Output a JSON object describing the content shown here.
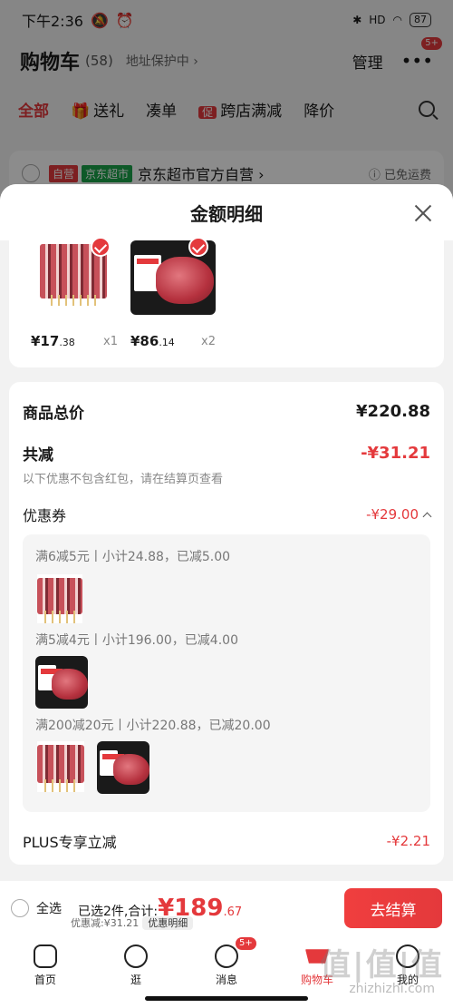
{
  "status": {
    "time": "下午2:36",
    "battery": "87",
    "signal": "HD"
  },
  "header": {
    "title": "购物车",
    "count": "(58)",
    "address": "地址保护中 ›",
    "manage": "管理",
    "more_badge": "5+"
  },
  "tabs": [
    "全部",
    "送礼",
    "凑单",
    "跨店满减",
    "降价"
  ],
  "promo_tag": "促",
  "shop": {
    "tag_self": "自营",
    "tag_market": "京东超市",
    "name": "京东超市官方自营 ›",
    "shipping": "已免运费"
  },
  "sheet": {
    "title": "金额明细",
    "products": [
      {
        "price_main": "¥17",
        "price_cents": ".38",
        "qty": "x1"
      },
      {
        "price_main": "¥86",
        "price_cents": ".14",
        "qty": "x2"
      }
    ],
    "total_label": "商品总价",
    "total_value": "¥220.88",
    "reduce_label": "共减",
    "reduce_value": "-¥31.21",
    "reduce_note": "以下优惠不包含红包，请在结算页查看",
    "coupon_label": "优惠券",
    "coupon_value": "-¥29.00",
    "coupon_lines": [
      "满6减5元丨小计24.88，已减5.00",
      "满5减4元丨小计196.00，已减4.00",
      "满200减20元丨小计220.88，已减20.00"
    ],
    "plus_label": "PLUS专享立减",
    "plus_value": "-¥2.21"
  },
  "checkout": {
    "select_all": "全选",
    "summary": "已选2件,合计:",
    "sum_main": "¥189",
    "sum_cents": ".67",
    "discount_note": "优惠减:¥31.21",
    "detail_pill": "优惠明细",
    "pay_button": "去结算"
  },
  "tabbar": [
    {
      "label": "首页"
    },
    {
      "label": "逛"
    },
    {
      "label": "消息",
      "badge": "5+"
    },
    {
      "label": "购物车"
    },
    {
      "label": "我的"
    }
  ],
  "watermark": {
    "big": "值|值|值",
    "url": "zhizhizhi.com"
  },
  "colors": {
    "accent": "#e4393c",
    "green": "#1aa34a"
  }
}
